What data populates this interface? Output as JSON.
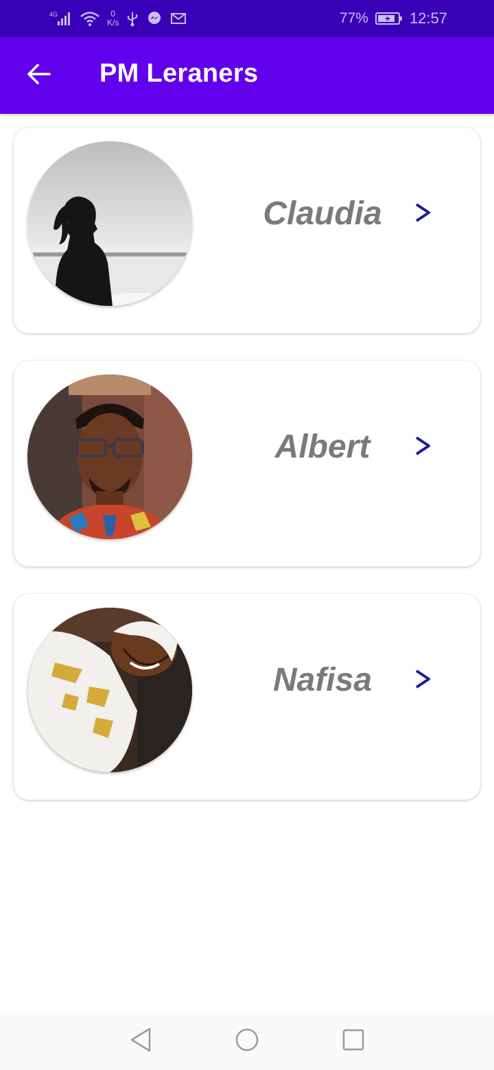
{
  "status_bar": {
    "network_label": "4G",
    "speed_value": "0",
    "speed_unit": "K/s",
    "battery_percent": "77%",
    "time": "12:57",
    "icons": [
      "signal-icon",
      "wifi-icon",
      "usb-icon",
      "messenger-icon",
      "gmail-icon",
      "battery-icon"
    ]
  },
  "app_bar": {
    "title": "PM Leraners",
    "back_icon": "arrow-left-icon",
    "background": "#6200ee"
  },
  "learners": [
    {
      "name": "Claudia",
      "avatar": "silhouette-beach-photo"
    },
    {
      "name": "Albert",
      "avatar": "man-glasses-photo"
    },
    {
      "name": "Nafisa",
      "avatar": "woman-headscarf-photo"
    }
  ],
  "colors": {
    "status_bar": "#3a00b8",
    "name_text": "#7a7a7a",
    "chevron": "#1a1aa0"
  },
  "nav_bar": {
    "buttons": [
      "back-triangle-icon",
      "home-circle-icon",
      "recents-square-icon"
    ]
  }
}
